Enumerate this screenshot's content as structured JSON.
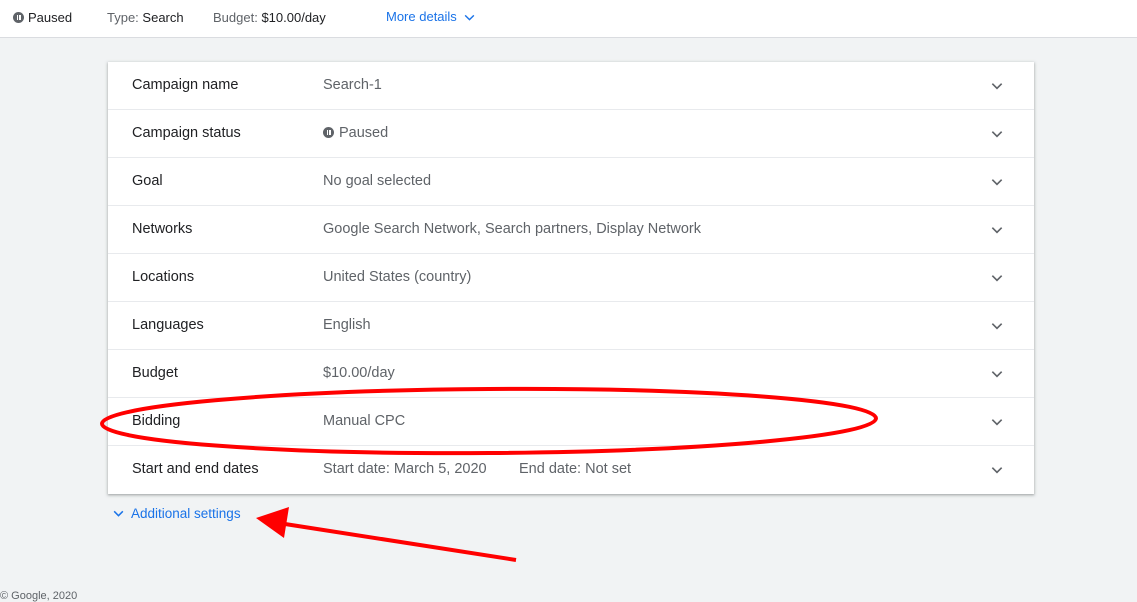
{
  "header": {
    "status": "Paused",
    "type_label": "Type:",
    "type_value": "Search",
    "budget_label": "Budget:",
    "budget_value": "$10.00/day",
    "more_details": "More details"
  },
  "settings": {
    "rows": [
      {
        "label": "Campaign name",
        "value": "Search-1"
      },
      {
        "label": "Campaign status",
        "value": "Paused"
      },
      {
        "label": "Goal",
        "value": "No goal selected"
      },
      {
        "label": "Networks",
        "value": "Google Search Network, Search partners, Display Network"
      },
      {
        "label": "Locations",
        "value": "United States (country)"
      },
      {
        "label": "Languages",
        "value": "English"
      },
      {
        "label": "Budget",
        "value": "$10.00/day"
      },
      {
        "label": "Bidding",
        "value": "Manual CPC"
      },
      {
        "label": "Start and end dates",
        "value": "Start date: March 5, 2020",
        "value2": "End date: Not set"
      }
    ]
  },
  "additional_settings": "Additional settings",
  "footer": "© Google, 2020",
  "colors": {
    "link": "#1a73e8",
    "annotation": "#ff0000"
  },
  "icons": [
    "pause-icon",
    "chevron-down-icon"
  ]
}
